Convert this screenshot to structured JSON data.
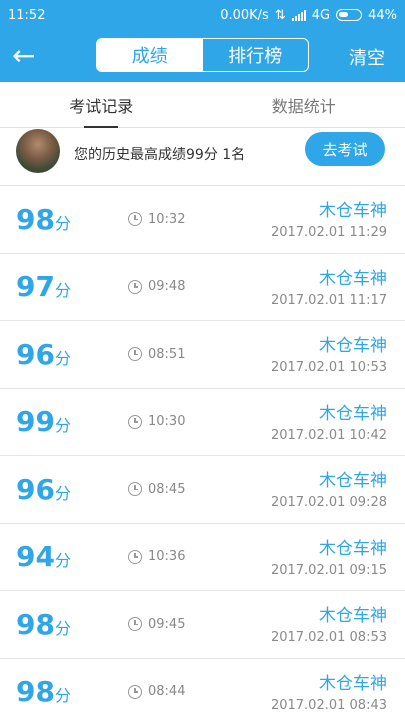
{
  "status": {
    "time": "11:52",
    "speed": "0.00K/s",
    "network": "4G",
    "battery": "44%"
  },
  "header": {
    "tab_scores": "成绩",
    "tab_ranking": "排行榜",
    "clear": "清空"
  },
  "subtabs": {
    "records": "考试记录",
    "stats": "数据统计"
  },
  "profile": {
    "text": "您的历史最高成绩99分  1名",
    "button": "去考试"
  },
  "records": [
    {
      "score": "98",
      "unit": "分",
      "duration": "10:32",
      "name": "木仓车神",
      "date": "2017.02.01  11:29"
    },
    {
      "score": "97",
      "unit": "分",
      "duration": "09:48",
      "name": "木仓车神",
      "date": "2017.02.01  11:17"
    },
    {
      "score": "96",
      "unit": "分",
      "duration": "08:51",
      "name": "木仓车神",
      "date": "2017.02.01  10:53"
    },
    {
      "score": "99",
      "unit": "分",
      "duration": "10:30",
      "name": "木仓车神",
      "date": "2017.02.01  10:42"
    },
    {
      "score": "96",
      "unit": "分",
      "duration": "08:45",
      "name": "木仓车神",
      "date": "2017.02.01  09:28"
    },
    {
      "score": "94",
      "unit": "分",
      "duration": "10:36",
      "name": "木仓车神",
      "date": "2017.02.01  09:15"
    },
    {
      "score": "98",
      "unit": "分",
      "duration": "09:45",
      "name": "木仓车神",
      "date": "2017.02.01  08:53"
    },
    {
      "score": "98",
      "unit": "分",
      "duration": "08:44",
      "name": "木仓车神",
      "date": "2017.02.01  08:43"
    }
  ]
}
